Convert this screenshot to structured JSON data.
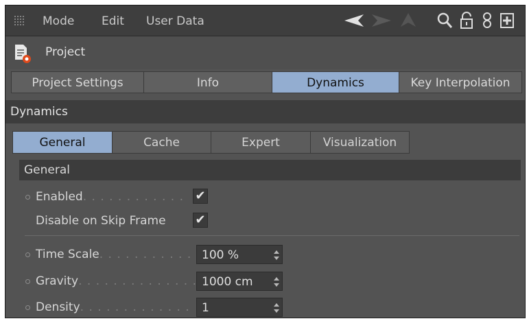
{
  "menu": {
    "items": [
      "Mode",
      "Edit",
      "User Data"
    ]
  },
  "toolbar_icons": [
    "back-arrow-icon",
    "forward-arrow-icon",
    "up-arrow-icon",
    "search-icon",
    "lock-icon",
    "link-icon",
    "new-window-icon"
  ],
  "project": {
    "icon": "project-icon",
    "label": "Project"
  },
  "tabs": [
    {
      "label": "Project Settings",
      "active": false
    },
    {
      "label": "Info",
      "active": false
    },
    {
      "label": "Dynamics",
      "active": true
    },
    {
      "label": "Key Interpolation",
      "active": false
    }
  ],
  "section": {
    "title": "Dynamics"
  },
  "subtabs": [
    {
      "label": "General",
      "active": true
    },
    {
      "label": "Cache",
      "active": false
    },
    {
      "label": "Expert",
      "active": false
    },
    {
      "label": "Visualization",
      "active": false
    }
  ],
  "group": {
    "title": "General"
  },
  "properties": {
    "enabled": {
      "label": "Enabled",
      "dots": ". . . . . . . . . . . .",
      "checked": true
    },
    "disable_skip": {
      "label": "Disable on Skip Frame",
      "checked": true
    },
    "time_scale": {
      "label": "Time Scale",
      "dots": ". . . . . . . . . . .",
      "value": "100 %"
    },
    "gravity": {
      "label": "Gravity",
      "dots": ". . . . . . . . . . . . . .",
      "value": "1000 cm"
    },
    "density": {
      "label": "Density",
      "dots": ". . . . . . . . . . . . .",
      "value": "1"
    }
  },
  "colors": {
    "accent": "#93add0",
    "panel": "#535353",
    "menubar": "#3e3e3e"
  }
}
